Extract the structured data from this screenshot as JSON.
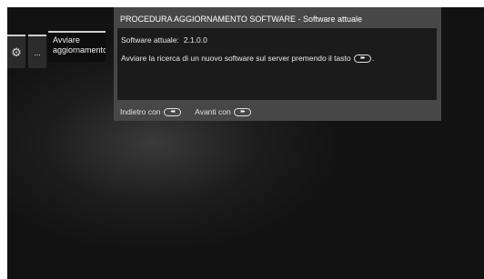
{
  "menu": {
    "settings_icon": "gear-icon",
    "more_label": "...",
    "active_label_line1": "Avviare",
    "active_label_line2": "aggiornamento"
  },
  "dialog": {
    "title": "PROCEDURA AGGIORNAMENTO SOFTWARE - Software attuale",
    "current_label": "Software attuale:",
    "current_value": "2.1.0.0",
    "instruction": "Avviare la ricerca di un nuovo software sul server premendo il tasto",
    "instruction_key_icon": "forward-key-icon",
    "instruction_end": ".",
    "back_label": "Indietro con",
    "back_key_icon": "rewind-key-icon",
    "forward_label": "Avanti con",
    "forward_key_icon": "forward-key-icon"
  }
}
